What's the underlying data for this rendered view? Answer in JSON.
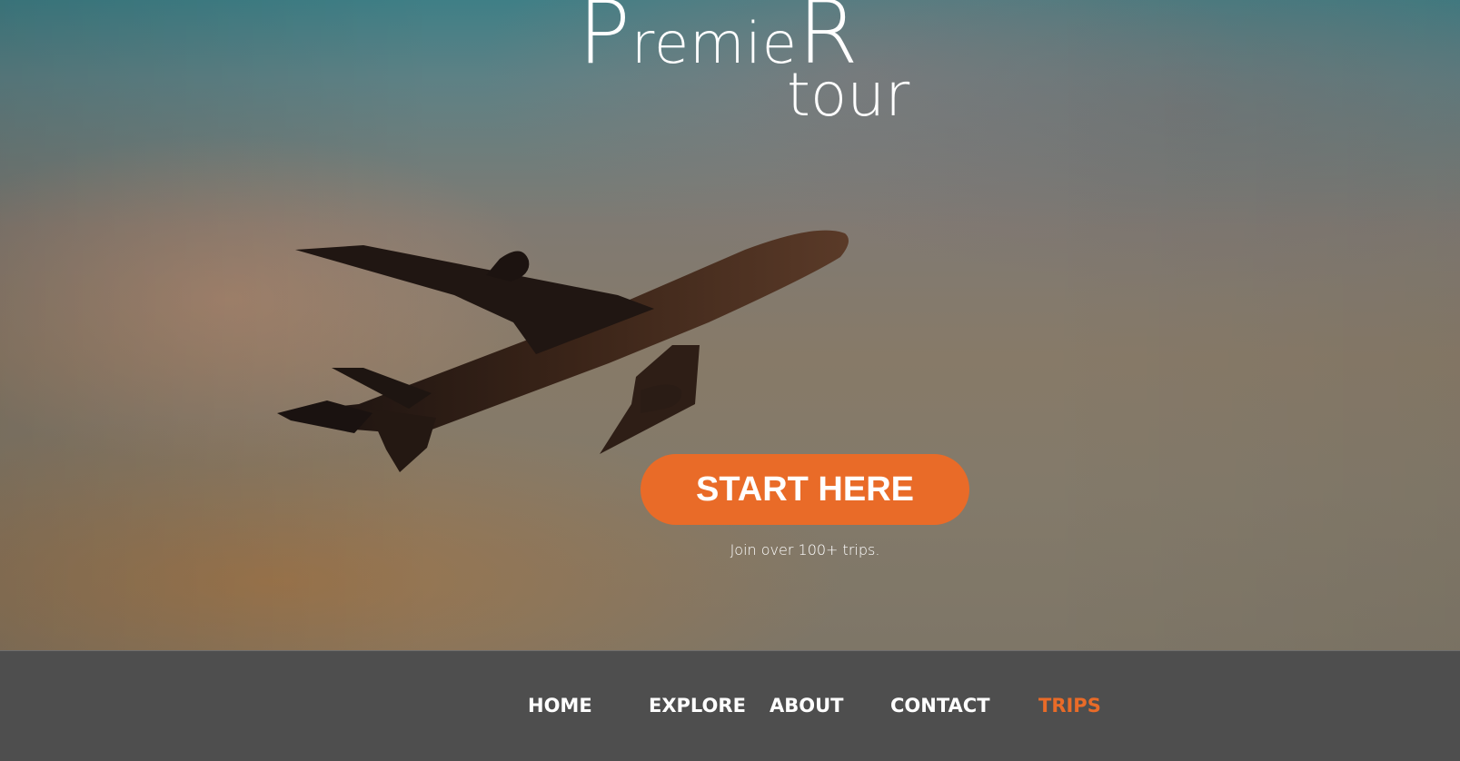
{
  "brand": {
    "title_cap_first": "P",
    "title_middle": "remie",
    "title_cap_last": "R",
    "subtitle": "tour"
  },
  "hero": {
    "cta_label": "START HERE",
    "tagline": "Join over 100+ trips.",
    "image_subject": "airplane-silhouette"
  },
  "nav": {
    "items": [
      {
        "label": "HOME"
      },
      {
        "label": "EXPLORE"
      },
      {
        "label": "ABOUT"
      },
      {
        "label": "CONTACT"
      },
      {
        "label": "TRIPS",
        "active": true
      }
    ]
  },
  "colors": {
    "accent": "#e96b28",
    "navbar_bg": "#4e4e4e",
    "text": "#ffffff"
  }
}
